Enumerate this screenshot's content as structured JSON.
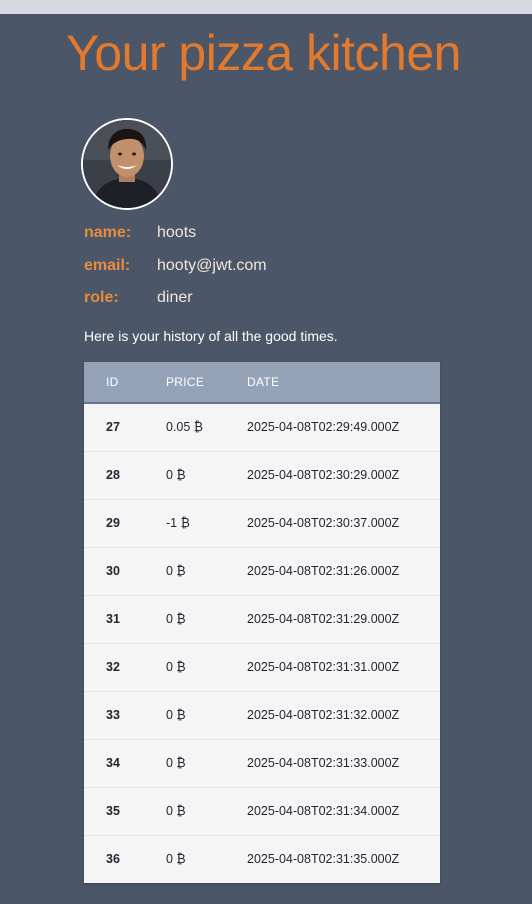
{
  "page": {
    "title": "Your pizza kitchen"
  },
  "profile": {
    "avatar": "user-avatar-photo",
    "name_label": "name:",
    "name_value": "hoots",
    "email_label": "email:",
    "email_value": "hooty@jwt.com",
    "role_label": "role:",
    "role_value": "diner"
  },
  "history": {
    "intro": "Here is your history of all the good times.",
    "columns": [
      "ID",
      "PRICE",
      "DATE"
    ],
    "rows": [
      {
        "id": "27",
        "price": "0.05 ₿",
        "date": "2025-04-08T02:29:49.000Z"
      },
      {
        "id": "28",
        "price": "0 ₿",
        "date": "2025-04-08T02:30:29.000Z"
      },
      {
        "id": "29",
        "price": "-1 ₿",
        "date": "2025-04-08T02:30:37.000Z"
      },
      {
        "id": "30",
        "price": "0 ₿",
        "date": "2025-04-08T02:31:26.000Z"
      },
      {
        "id": "31",
        "price": "0 ₿",
        "date": "2025-04-08T02:31:29.000Z"
      },
      {
        "id": "32",
        "price": "0 ₿",
        "date": "2025-04-08T02:31:31.000Z"
      },
      {
        "id": "33",
        "price": "0 ₿",
        "date": "2025-04-08T02:31:32.000Z"
      },
      {
        "id": "34",
        "price": "0 ₿",
        "date": "2025-04-08T02:31:33.000Z"
      },
      {
        "id": "35",
        "price": "0 ₿",
        "date": "2025-04-08T02:31:34.000Z"
      },
      {
        "id": "36",
        "price": "0 ₿",
        "date": "2025-04-08T02:31:35.000Z"
      }
    ]
  },
  "colors": {
    "background": "#4b5668",
    "title": "#e2792d",
    "label": "#e98b3e",
    "table_header": "#94a3b8"
  }
}
